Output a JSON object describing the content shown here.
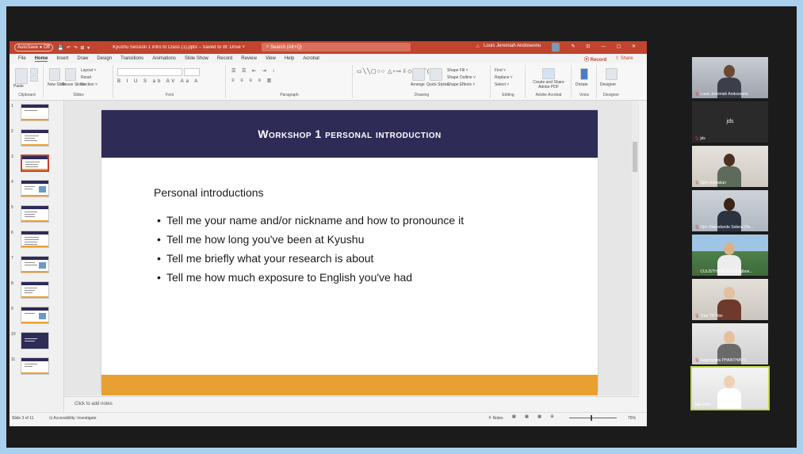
{
  "ppt": {
    "titlebar": {
      "autosave": "AutoSave ● Off",
      "quick_access": "💾 ↶ ↷ ⊞ ▾",
      "doc_title": "Kyushu Session 1 intro to Class (1).pptx – Saved to W: Drive ˅",
      "search": "Search (Alt+Q)",
      "warning": "⚠",
      "user": "Louis Jeremiah Andoseonu",
      "icons": "✎ ⊡ — ▢ ✕"
    },
    "menu": [
      "File",
      "Home",
      "Insert",
      "Draw",
      "Design",
      "Transitions",
      "Animations",
      "Slide Show",
      "Record",
      "Review",
      "View",
      "Help",
      "Acrobat"
    ],
    "active_menu": "Home",
    "record": "⦿ Record",
    "share": "⇪ Share",
    "ribbon_groups": [
      "Clipboard",
      "Slides",
      "Font",
      "Paragraph",
      "Drawing",
      "Editing",
      "Adobe Acrobat",
      "Voice",
      "Designer"
    ],
    "ribbon_labels": {
      "paste": "Paste",
      "new_slide": "New Slide",
      "reuse_slides": "Reuse Slides",
      "layout": "Layout ˅",
      "reset": "Reset",
      "section": "Section ˅",
      "arrange": "Arrange",
      "quick_styles": "Quick Styles",
      "shape_fill": "Shape Fill ˅",
      "shape_outline": "Shape Outline ˅",
      "shape_effects": "Shape Effects ˅",
      "find": "Find ˅",
      "replace": "Replace ˅",
      "select": "Select ˅",
      "create_share": "Create and Share Adobe PDF",
      "dictate": "Dictate",
      "designer": "Designer"
    },
    "slide_numbers": [
      "1",
      "2",
      "3",
      "4",
      "5",
      "6",
      "7",
      "8",
      "9",
      "10",
      "11"
    ],
    "selected_slide": 3,
    "slide": {
      "title": "Workshop 1 personal introduction",
      "heading": "Personal introductions",
      "bullet_char": "•",
      "bullets": [
        "Tell me your name and/or nickname and how to pronounce it",
        "Tell me how long you've been at Kyushu",
        "Tell me briefly what your research is about",
        "Tell me how much exposure to English you've had"
      ]
    },
    "notes_placeholder": "Click to add notes",
    "status": {
      "slide_of": "Slide 3 of 11",
      "accessibility": "⊡ Accessibility: Investigate",
      "notes": "≜ Notes",
      "views": "▦ ▦ ▦ ⊞",
      "zoom": "75%"
    }
  },
  "zoom_gallery": {
    "participants": [
      {
        "name": "Louis Jeremiah Andoseonu",
        "kind": "video"
      },
      {
        "name": "jds",
        "kind": "name-only"
      },
      {
        "name": "Ojeh Adelakun",
        "kind": "video"
      },
      {
        "name": "Ojei Olabodunde Sebesi (Ve...",
        "kind": "video"
      },
      {
        "name": "CULISTHIRPLATA Khojiboe...",
        "kind": "video"
      },
      {
        "name": "Tran Thi Van",
        "kind": "video"
      },
      {
        "name": "Sagenpatra PHANTHAVO",
        "kind": "video"
      },
      {
        "name": "Nari Aoki",
        "kind": "video"
      }
    ]
  },
  "colors": {
    "frame_border": "#a9d0ec",
    "titlebar": "#c1442e",
    "slide_title_band": "#2e2b57",
    "slide_footer": "#e9a032",
    "zoom_bg": "#1b1b1b",
    "active_speaker_outline": "#c8d84a"
  }
}
